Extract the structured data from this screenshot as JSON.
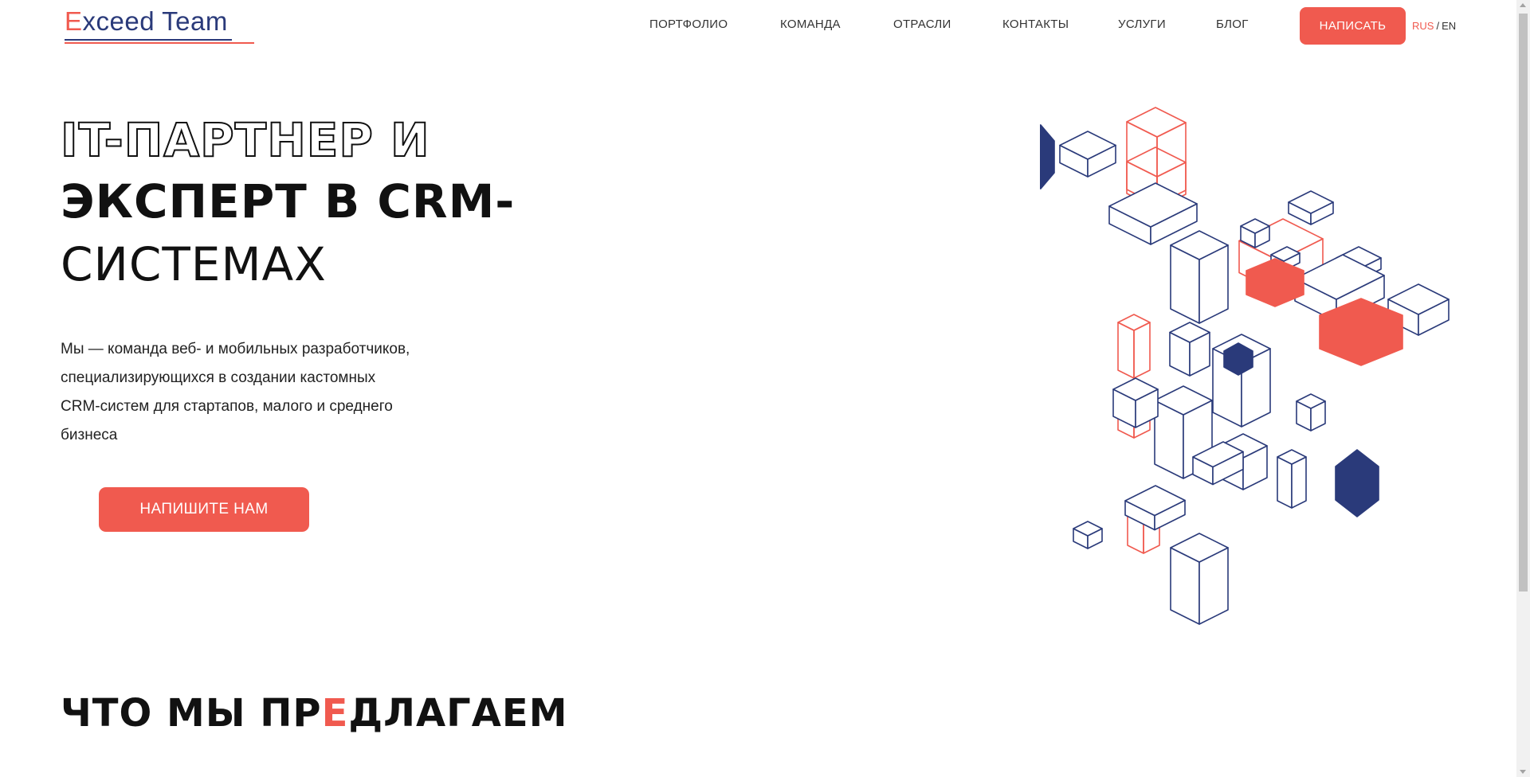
{
  "header": {
    "logo": {
      "first_letter": "E",
      "rest": "xceed Team"
    },
    "nav": [
      {
        "label": "ПОРТФОЛИО"
      },
      {
        "label": "КОМАНДА"
      },
      {
        "label": "ОТРАСЛИ"
      },
      {
        "label": "КОНТАКТЫ"
      },
      {
        "label": "УСЛУГИ"
      },
      {
        "label": "БЛОГ"
      }
    ],
    "cta_label": "НАПИСАТЬ",
    "lang": {
      "active": "RUS",
      "separator": "/",
      "other": "EN"
    }
  },
  "hero": {
    "line1": "IT-ПАРТНЕР И",
    "line2": "ЭКСПЕРТ В CRM-",
    "line3": "СИСТЕМАХ",
    "description": "Мы — команда веб- и мобильных разработчиков, специализирующихся в создании кастомных CRM-систем для стартапов, малого и среднего бизнеса",
    "cta_label": "НАПИШИТЕ НАМ"
  },
  "section": {
    "title_part1": "ЧТО МЫ ПР",
    "title_accent": "Е",
    "title_part2": "ДЛАГАЕМ"
  },
  "colors": {
    "accent": "#f05a4f",
    "navy": "#2a3a7a",
    "text": "#111111"
  }
}
